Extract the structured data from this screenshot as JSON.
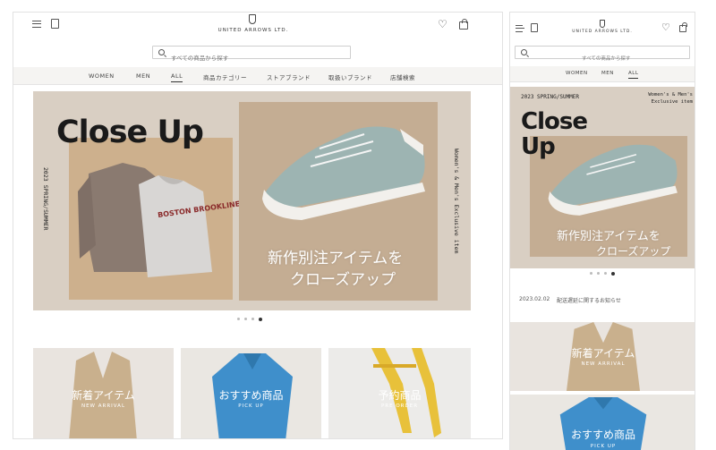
{
  "brand": {
    "name": "UNITED ARROWS LTD."
  },
  "search": {
    "placeholder": "すべての商品から探す"
  },
  "nav": {
    "items": [
      "WOMEN",
      "MEN",
      "ALL",
      "商品カテゴリー",
      "ストアブランド",
      "取扱いブランド",
      "店舗検索"
    ],
    "active": "ALL"
  },
  "hero": {
    "title_desktop": "Close Up",
    "title_mobile_line1": "Close",
    "title_mobile_line2": "Up",
    "season": "2023 SPRING/SUMMER",
    "exclusive": "Women's & Men's Exclusive item",
    "exclusive_line1": "Women's & Men's",
    "exclusive_line2": "Exclusive item",
    "jp_line1": "新作別注アイテムを",
    "jp_line2": "クローズアップ",
    "sweater_text": "BOSTON BROOKLINE",
    "slides": 4,
    "active_slide": 4
  },
  "news": {
    "date": "2023.02.02",
    "text": "配送遅延に関するお知らせ"
  },
  "tiles": [
    {
      "title": "新着アイテム",
      "sub": "NEW ARRIVAL"
    },
    {
      "title": "おすすめ商品",
      "sub": "PICK UP"
    },
    {
      "title": "予約商品",
      "sub": "PRE ORDER"
    }
  ],
  "colors": {
    "hero_bg": "#d9cfc3",
    "nav_bg": "#f5f4f2",
    "sneaker": "#9db4b2",
    "shirt": "#3f8fcb",
    "sandal": "#e8c13a"
  }
}
